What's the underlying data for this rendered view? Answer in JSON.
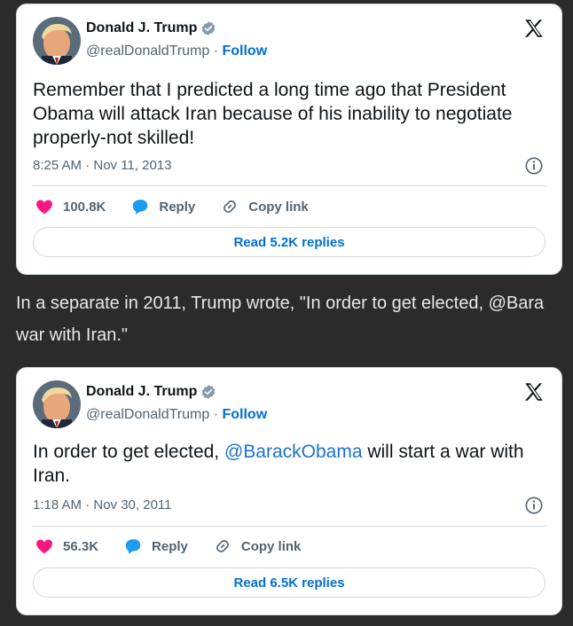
{
  "tweets": [
    {
      "author": {
        "name": "Donald J. Trump",
        "handle": "@realDonaldTrump",
        "follow_label": "Follow"
      },
      "text": "Remember that I predicted a long time ago that President Obama will attack Iran because of his inability to negotiate properly-not skilled!",
      "timestamp": "8:25 AM · Nov 11, 2013",
      "likes": "100.8K",
      "reply_label": "Reply",
      "copy_link_label": "Copy link",
      "read_replies_label": "Read 5.2K replies"
    },
    {
      "author": {
        "name": "Donald J. Trump",
        "handle": "@realDonaldTrump",
        "follow_label": "Follow"
      },
      "text_before": "In order to get elected, ",
      "mention": "@BarackObama",
      "text_after": " will start a war with Iran.",
      "timestamp": "1:18 AM · Nov 30, 2011",
      "likes": "56.3K",
      "reply_label": "Reply",
      "copy_link_label": "Copy link",
      "read_replies_label": "Read 6.5K replies"
    }
  ],
  "article": {
    "line1": "In a separate in 2011, Trump wrote, \"In order to get elected, @Bara",
    "line2": "war with Iran.\""
  },
  "separator": " · ",
  "colors": {
    "background": "#2b2b2b",
    "card": "#ffffff",
    "link_blue": "#006fd6",
    "mention_blue": "#1d74c9",
    "heart_pink": "#f91880",
    "reply_blue": "#1d9bf0",
    "verified_gray": "#829aab"
  },
  "icons": [
    "verified-badge-icon",
    "x-logo-icon",
    "info-icon",
    "heart-icon",
    "reply-bubble-icon",
    "link-icon"
  ]
}
